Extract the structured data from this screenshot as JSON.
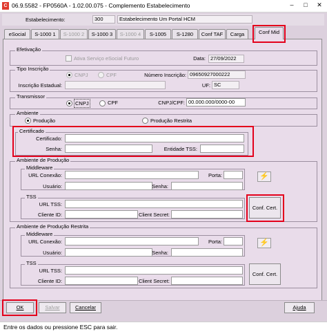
{
  "window": {
    "title": "06.9.5582 - FP0560A - 1.02.00.075 - Complemento Estabelecimento",
    "icon_text": "C",
    "controls": [
      "–",
      "□",
      "✕"
    ]
  },
  "header": {
    "label": "Estabelecimento:",
    "code": "300",
    "name": "Estabelecimento Um Portal HCM"
  },
  "tabs": [
    {
      "label": "eSocial",
      "enabled": true
    },
    {
      "label": "S-1000 1",
      "enabled": true
    },
    {
      "label": "S-1000 2",
      "enabled": false
    },
    {
      "label": "S-1000 3",
      "enabled": true
    },
    {
      "label": "S-1000 4",
      "enabled": false
    },
    {
      "label": "S-1005",
      "enabled": true
    },
    {
      "label": "S-1280",
      "enabled": true
    },
    {
      "label": "Conf TAF",
      "enabled": true
    },
    {
      "label": "Carga",
      "enabled": true
    },
    {
      "label": "Conf Mid",
      "enabled": true,
      "active": true
    }
  ],
  "efetivacao": {
    "title": "Efetivação",
    "checkbox_label": "Ativa Serviço eSocial Futuro",
    "checked": false,
    "date_label": "Data:",
    "date_value": "27/09/2022"
  },
  "tipo_inscricao": {
    "title": "Tipo Inscrição",
    "radio_cnpj": "CNPJ",
    "radio_cpf": "CPF",
    "selected": "CNPJ",
    "numero_label": "Número Inscrição:",
    "numero_value": "09650927000222",
    "ie_label": "Inscrição Estadual:",
    "ie_value": "",
    "uf_label": "UF:",
    "uf_value": "SC"
  },
  "transmissor": {
    "title": "Transmissor",
    "radio_cnpj": "CNPJ",
    "radio_cpf": "CPF",
    "selected": "CNPJ",
    "doc_label": "CNPJ/CPF:",
    "doc_value": "00.000.000/0000-00"
  },
  "ambiente": {
    "title": "Ambiente",
    "opt_producao": "Produção",
    "opt_restrita": "Produção Restrita",
    "selected": "Produção"
  },
  "certificado": {
    "title": "Certificado",
    "cert_label": "Certificado:",
    "cert_value": "",
    "senha_label": "Senha:",
    "senha_value": "",
    "tss_label": "Entidade TSS:",
    "tss_value": ""
  },
  "amb_producao": {
    "title": "Ambiente de Produção",
    "middleware": {
      "title": "Middleware",
      "url_label": "URL Conexão:",
      "url_value": "",
      "porta_label": "Porta:",
      "porta_value": "",
      "usuario_label": "Usuário:",
      "usuario_value": "",
      "senha_label": "Senha:",
      "senha_value": ""
    },
    "tss": {
      "title": "TSS",
      "url_label": "URL TSS:",
      "url_value": "",
      "cliente_label": "Cliente ID:",
      "cliente_value": "",
      "secret_label": "Client Secret:",
      "secret_value": "",
      "conf_button": "Conf. Cert."
    }
  },
  "amb_restrita": {
    "title": "Ambiente de Produção Restrita",
    "middleware": {
      "title": "Middleware",
      "url_label": "URL Conexão:",
      "url_value": "",
      "porta_label": "Porta:",
      "porta_value": "",
      "usuario_label": "Usuário:",
      "usuario_value": "",
      "senha_label": "Senha:",
      "senha_value": ""
    },
    "tss": {
      "title": "TSS",
      "url_label": "URL TSS:",
      "url_value": "",
      "cliente_label": "Cliente ID:",
      "cliente_value": "",
      "secret_label": "Client Secret:",
      "secret_value": "",
      "conf_button": "Conf. Cert."
    }
  },
  "buttons": {
    "ok": "OK",
    "salvar": "Salvar",
    "cancelar": "Cancelar",
    "ajuda": "Ajuda"
  },
  "status_text": "Entre os dados ou pressione ESC para sair.",
  "colors": {
    "highlight": "#e3001b",
    "panel": "#e9dcea"
  }
}
